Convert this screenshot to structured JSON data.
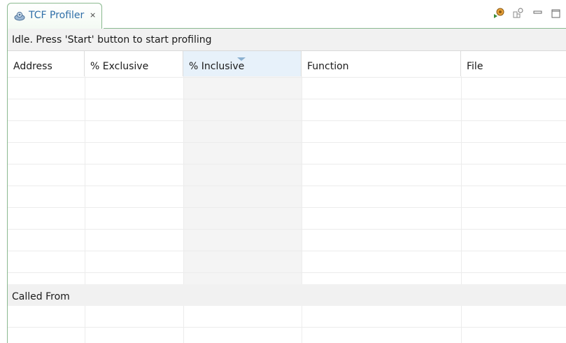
{
  "tab": {
    "title": "TCF Profiler",
    "close_glyph": "⨯",
    "icon": "profiler-icon"
  },
  "toolbar": {
    "buttons": [
      {
        "name": "start-profiling-icon"
      },
      {
        "name": "configure-icon"
      },
      {
        "name": "minimize-icon"
      },
      {
        "name": "maximize-icon"
      }
    ]
  },
  "status": {
    "text": "Idle. Press 'Start' button to start profiling"
  },
  "main_table": {
    "columns": [
      "Address",
      "% Exclusive",
      "% Inclusive",
      "Function",
      "File"
    ],
    "sorted_column": "% Inclusive",
    "rows": []
  },
  "called_from": {
    "title": "Called From",
    "rows": []
  },
  "colors": {
    "tab_border": "#8ab98f",
    "tab_text": "#2f6fa8",
    "sort_highlight": "#e7f1fa"
  }
}
